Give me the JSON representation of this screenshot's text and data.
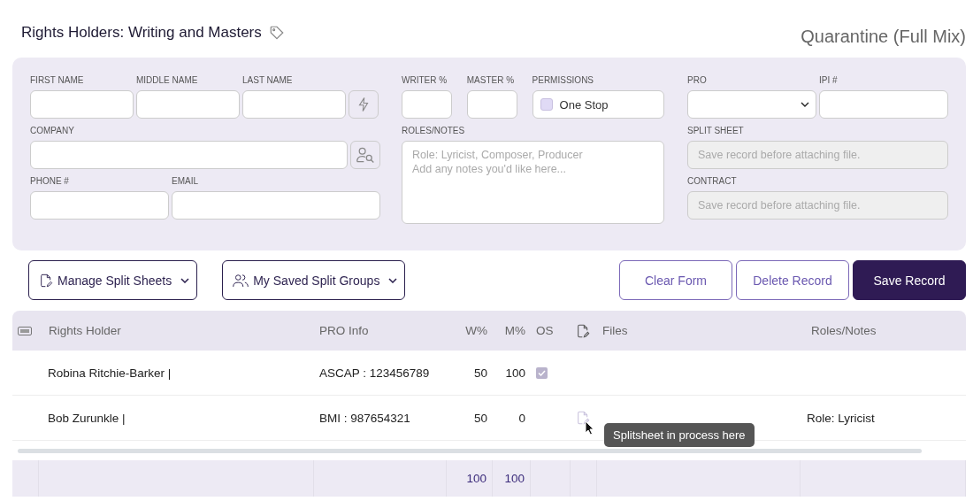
{
  "title": "Rights Holders: Writing and Masters",
  "song": "Quarantine (Full Mix)",
  "form": {
    "first_name": {
      "label": "FIRST NAME"
    },
    "middle_name": {
      "label": "MIDDLE NAME"
    },
    "last_name": {
      "label": "LAST NAME"
    },
    "company": {
      "label": "COMPANY"
    },
    "phone": {
      "label": "PHONE #"
    },
    "email": {
      "label": "EMAIL"
    },
    "writer": {
      "label": "WRITER %"
    },
    "master": {
      "label": "MASTER %"
    },
    "permissions": {
      "label": "PERMISSIONS",
      "option": "One Stop",
      "checked": false
    },
    "roles": {
      "label": "ROLES/NOTES",
      "placeholder_lines": [
        "Role: Lyricist, Composer, Producer",
        "Add any notes you'd like here..."
      ]
    },
    "pro": {
      "label": "PRO"
    },
    "ipi": {
      "label": "IPI #"
    },
    "split_sheet": {
      "label": "SPLIT SHEET",
      "placeholder": "Save record before attaching file.",
      "disabled": true
    },
    "contract": {
      "label": "CONTRACT",
      "placeholder": "Save record before attaching file.",
      "disabled": true
    }
  },
  "menus": [
    {
      "label": "Manage Split Sheets",
      "kind": "file"
    },
    {
      "label": "My Saved Split Groups",
      "kind": "group"
    }
  ],
  "actions": [
    {
      "label": "Clear Form",
      "primary": false
    },
    {
      "label": "Delete Record",
      "primary": false
    },
    {
      "label": "Save Record",
      "primary": true
    }
  ],
  "table": {
    "columns": {
      "holder": "Rights Holder",
      "pro": "PRO Info",
      "writer": "W%",
      "master": "M%",
      "os": "OS",
      "files": "Files",
      "roles": "Roles/Notes"
    },
    "rows": [
      {
        "holder": "Robina Ritchie-Barker |",
        "pro": "ASCAP : 123456789",
        "writer": "50",
        "master": "100",
        "one_stop": true,
        "splitsheet": false
      },
      {
        "holder": "Bob Zurunkle |",
        "pro": "BMI : 987654321",
        "writer": "50",
        "master": "0",
        "one_stop": false,
        "splitsheet": true,
        "roles": "Role: Lyricist"
      }
    ],
    "totals": {
      "writer": "100",
      "master": "100"
    }
  },
  "tooltip": "Splitsheet in process here"
}
